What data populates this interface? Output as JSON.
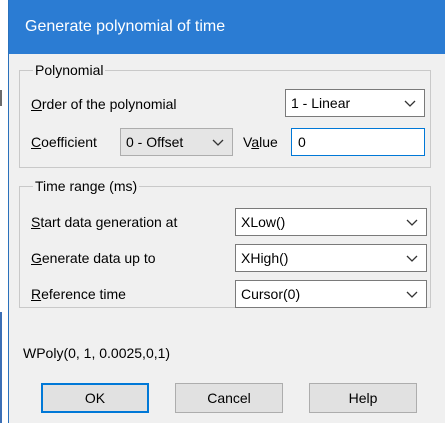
{
  "window": {
    "title": "Generate polynomial of time"
  },
  "polynomial": {
    "group_label": "Polynomial",
    "order_label": "Order of the polynomial",
    "order_value": "1 - Linear",
    "coefficient_label": "Coefficient",
    "coefficient_value": "0 - Offset",
    "value_label": "Value",
    "value_input": "0"
  },
  "time_range": {
    "group_label": "Time range (ms)",
    "start_label": "Start data generation at",
    "start_value": "XLow()",
    "upto_label": "Generate data up to",
    "upto_value": "XHigh()",
    "reference_label": "Reference time",
    "reference_value": "Cursor(0)"
  },
  "expression": "WPoly(0, 1, 0.0025,0,1)",
  "buttons": {
    "ok": "OK",
    "cancel": "Cancel",
    "help": "Help"
  },
  "icons": {
    "dropdown": "chevron-down-icon"
  },
  "colors": {
    "titlebar": "#2b7cd3",
    "focus_border": "#0078d7",
    "dialog_bg": "#f0f0f0"
  }
}
